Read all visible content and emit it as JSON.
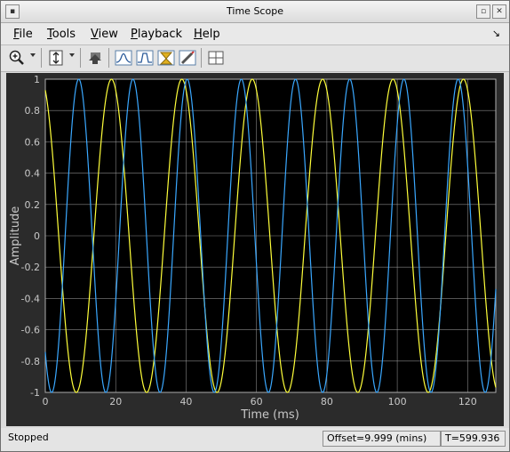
{
  "window": {
    "title": "Time Scope"
  },
  "menu": [
    {
      "key": "F",
      "rest": "ile"
    },
    {
      "key": "T",
      "rest": "ools"
    },
    {
      "key": "V",
      "rest": "iew"
    },
    {
      "key": "P",
      "rest": "layback"
    },
    {
      "key": "H",
      "rest": "elp"
    }
  ],
  "toolbar": {
    "icons": [
      "zoom-in-icon",
      "zoom-dropdown-icon",
      "autoscale-icon",
      "autoscale-dropdown-icon",
      "highlight-simulink-signal-icon",
      "signal-statistics-icon",
      "bilevel-measurements-icon",
      "peak-finder-icon",
      "triggers-icon",
      "layout-icon"
    ]
  },
  "colors": {
    "background": "#000000",
    "panel": "#2b2b2b",
    "grid": "#a8a8a8",
    "series1": "#ffff3a",
    "series2": "#3aa8ff"
  },
  "status": {
    "state": "Stopped",
    "offset": "Offset=9.999 (mins)",
    "time": "T=599.936"
  },
  "chart_data": {
    "type": "line",
    "xlabel": "Time (ms)",
    "ylabel": "Amplitude",
    "xlim": [
      0,
      128
    ],
    "ylim": [
      -1,
      1
    ],
    "xticks": [
      "0",
      "20",
      "40",
      "60",
      "80",
      "100",
      "120"
    ],
    "xtick_values": [
      0,
      20,
      40,
      60,
      80,
      100,
      120
    ],
    "yticks": [
      "-1",
      "-0.8",
      "-0.6",
      "-0.4",
      "-0.2",
      "0",
      "0.2",
      "0.4",
      "0.6",
      "0.8",
      "1"
    ],
    "ytick_values": [
      -1,
      -0.8,
      -0.6,
      -0.4,
      -0.2,
      0,
      0.2,
      0.4,
      0.6,
      0.8,
      1
    ],
    "grid": true,
    "series": [
      {
        "function": "cos",
        "period_ms": 20,
        "phase_ms": -1.2,
        "amplitude": 1,
        "color": "#ffff3a"
      },
      {
        "function": "cos",
        "period_ms": 15.4,
        "phase_ms": 9.5,
        "amplitude": 1,
        "color": "#3aa8ff"
      }
    ]
  }
}
